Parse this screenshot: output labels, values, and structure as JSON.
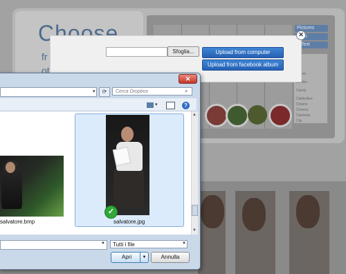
{
  "background": {
    "hero_title": "Choose",
    "hero_line1": "fr",
    "hero_line2": "ot",
    "tabs": [
      "Pictures",
      "...cts",
      "...Text"
    ],
    "list_items": [
      "Indoor",
      "Bambu",
      "Candy",
      "Celebrities",
      "Clowns",
      "Cinema",
      "Cartoons",
      "City"
    ]
  },
  "upload_dialog": {
    "browse_label": "Sfoglia...",
    "upload_computer_label": "Upload from computer",
    "upload_facebook_label": "Upload from facebook album",
    "close_glyph": "✕"
  },
  "file_dialog": {
    "close_glyph": "✕",
    "search_placeholder": "Cerca Dropbox",
    "files": [
      {
        "name": "salvatore.bmp"
      },
      {
        "name": "salvatore.jpg"
      }
    ],
    "filetype_value": "Tutti i file",
    "open_label": "Apri",
    "cancel_label": "Annulla"
  },
  "colors": {
    "accent_blue": "#2f6dc4",
    "dialog_frame": "#cad9ea",
    "selected_fill": "#dcebfc",
    "check_green": "#2fa838"
  }
}
